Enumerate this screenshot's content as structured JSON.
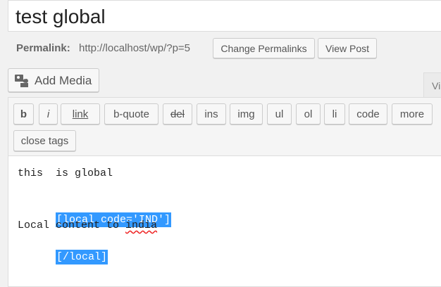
{
  "post": {
    "title": "test global"
  },
  "permalink": {
    "label": "Permalink:",
    "url": "http://localhost/wp/?p=5",
    "change_button": "Change Permalinks",
    "view_button": "View Post"
  },
  "media": {
    "add_label": "Add Media",
    "icon": "media-icon"
  },
  "tabs": {
    "visual_partial": "Vi"
  },
  "quicktags": {
    "b": "b",
    "i": "i",
    "link": "link",
    "bquote": "b-quote",
    "del": "del",
    "ins": "ins",
    "img": "img",
    "ul": "ul",
    "ol": "ol",
    "li": "li",
    "code": "code",
    "more": "more",
    "close": "close tags"
  },
  "editor": {
    "line1": "this  is global",
    "line2": "[local code='IND']",
    "line3_prefix": "Local content to ",
    "line3_word": "india",
    "line4": "[/local]",
    "selection_color": "#3399ff"
  }
}
